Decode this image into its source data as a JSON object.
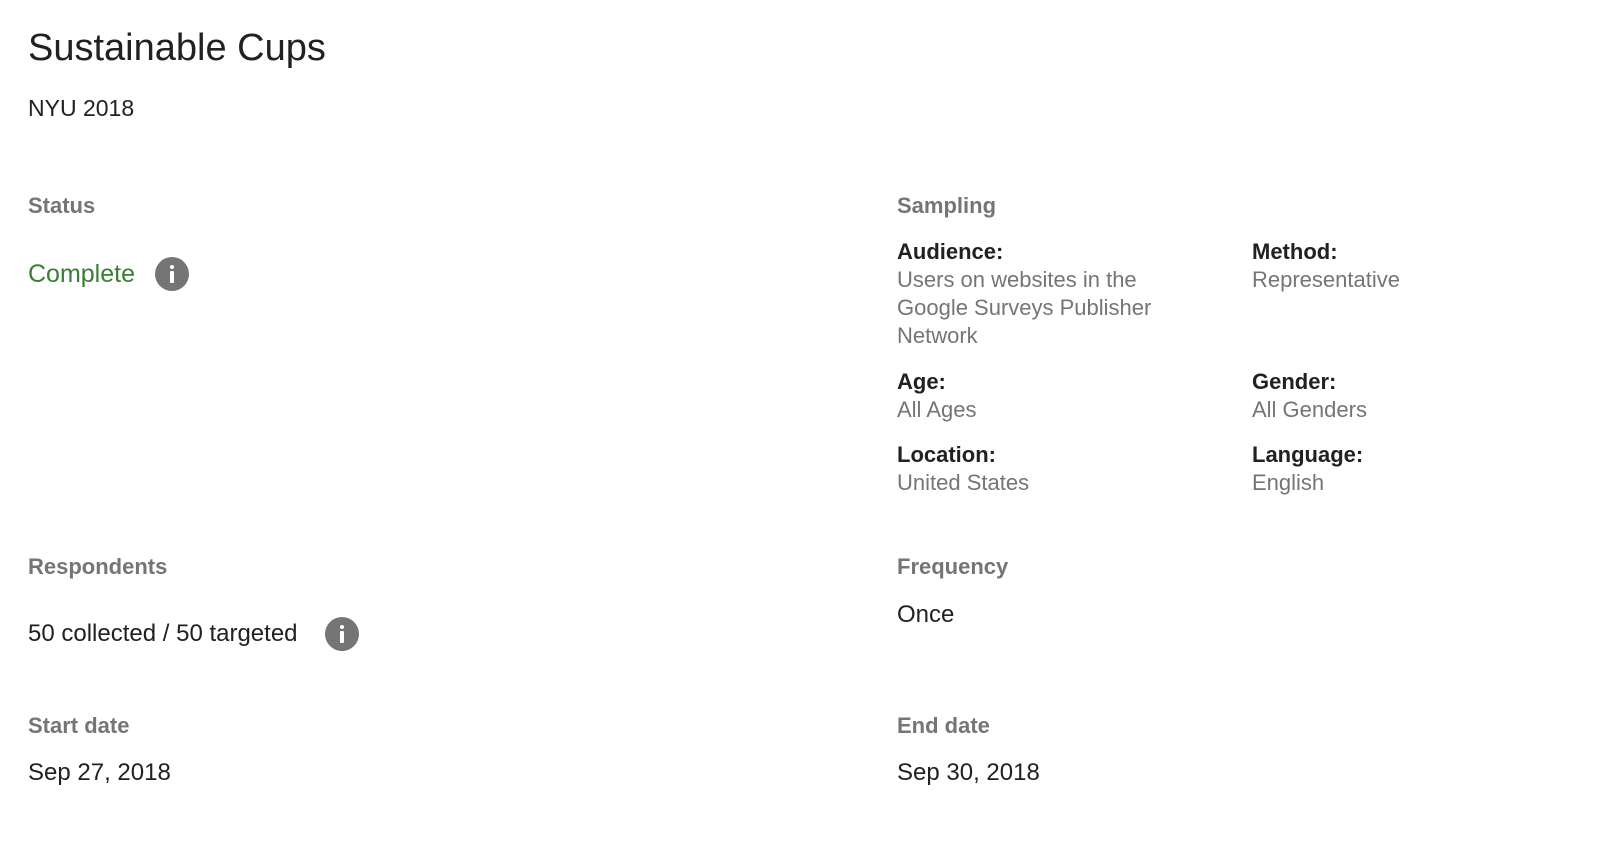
{
  "header": {
    "title": "Sustainable Cups",
    "subtitle": "NYU 2018"
  },
  "status": {
    "label": "Status",
    "value": "Complete",
    "value_color": "#3a7d34",
    "info_icon": "info-icon"
  },
  "sampling": {
    "label": "Sampling",
    "fields": {
      "audience": {
        "label": "Audience:",
        "value": "Users on websites in the Google Surveys Publisher Network"
      },
      "method": {
        "label": "Method:",
        "value": "Representative"
      },
      "age": {
        "label": "Age:",
        "value": "All Ages"
      },
      "gender": {
        "label": "Gender:",
        "value": "All Genders"
      },
      "location": {
        "label": "Location:",
        "value": "United States"
      },
      "language": {
        "label": "Language:",
        "value": "English"
      }
    }
  },
  "respondents": {
    "label": "Respondents",
    "value": "50 collected / 50 targeted",
    "info_icon": "info-icon"
  },
  "frequency": {
    "label": "Frequency",
    "value": "Once"
  },
  "start_date": {
    "label": "Start date",
    "value": "Sep 27, 2018"
  },
  "end_date": {
    "label": "End date",
    "value": "Sep 30, 2018"
  }
}
